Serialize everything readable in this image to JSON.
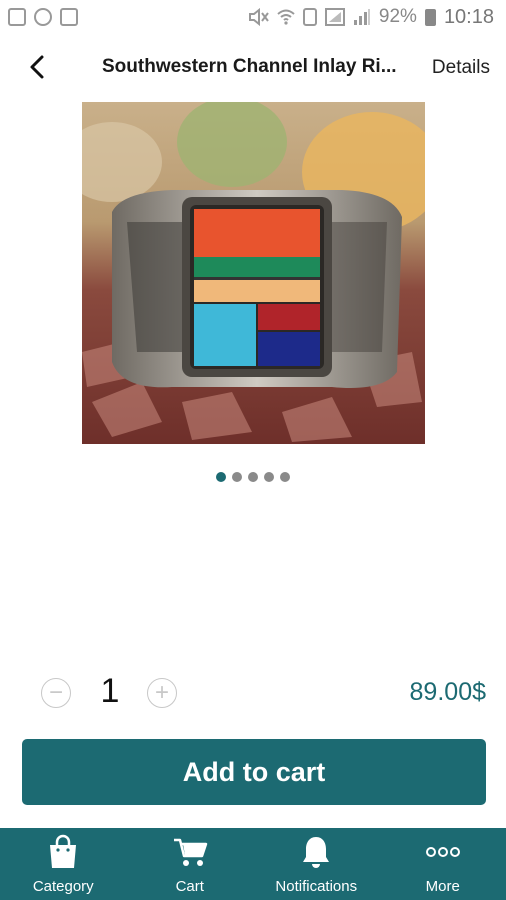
{
  "status_bar": {
    "battery_percent": "92%",
    "time": "10:18",
    "icons_left": [
      "gallery-icon",
      "whatsapp-icon",
      "calendar-icon"
    ],
    "icons_right": [
      "mute-icon",
      "wifi-icon",
      "sim-icon",
      "signal-icon",
      "battery-icon"
    ]
  },
  "header": {
    "title": "Southwestern Channel Inlay Ri...",
    "details_label": "Details",
    "back_icon": "chevron-left-icon"
  },
  "carousel": {
    "image_subject": "silver ring with multicolor channel inlay",
    "total": 5,
    "active_index": 0
  },
  "purchase": {
    "quantity": "1",
    "minus_symbol": "−",
    "plus_symbol": "+",
    "price": "89.00$",
    "add_to_cart_label": "Add to cart"
  },
  "bottom_nav": {
    "items": [
      {
        "label": "Category",
        "icon": "shopping-bag-icon"
      },
      {
        "label": "Cart",
        "icon": "cart-icon"
      },
      {
        "label": "Notifications",
        "icon": "bell-icon"
      },
      {
        "label": "More",
        "icon": "more-dots-icon"
      }
    ]
  },
  "colors": {
    "accent": "#1c6a72",
    "price": "#1c6a72",
    "dot_inactive": "#8a8a8a"
  }
}
